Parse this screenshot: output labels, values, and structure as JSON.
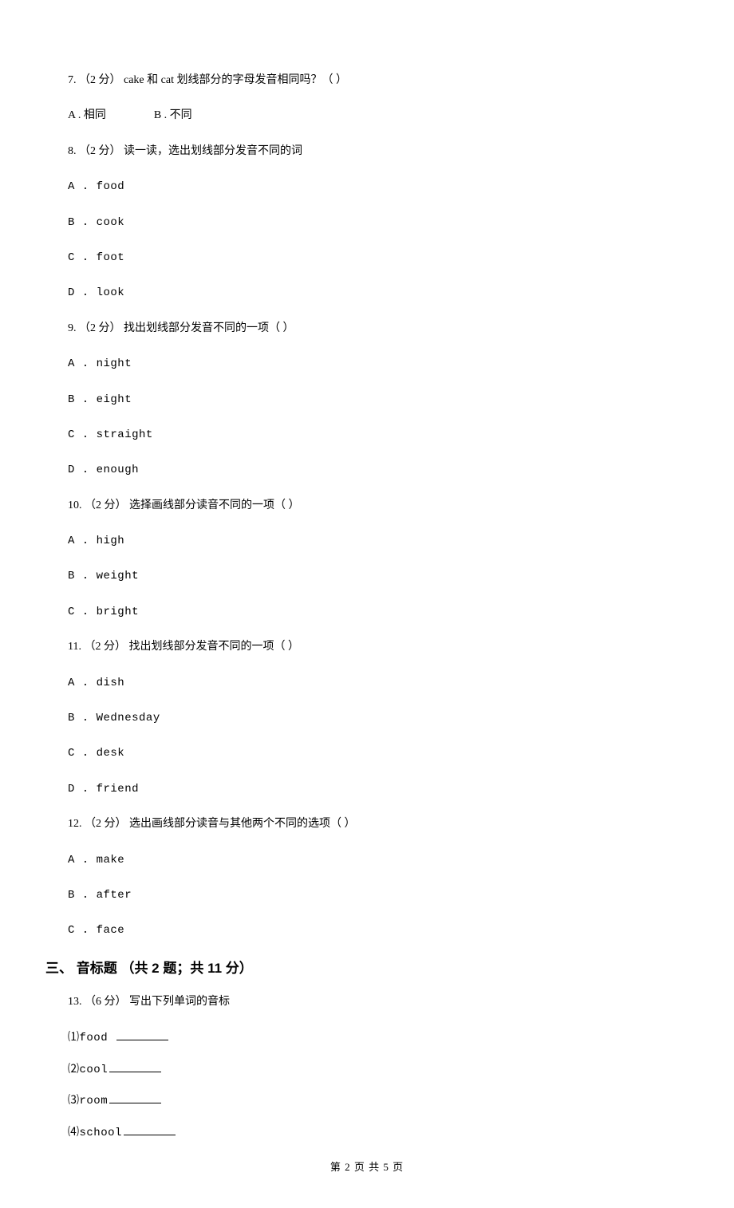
{
  "q7": {
    "stem": "7. （2 分） cake 和 cat 划线部分的字母发音相同吗？（    ）",
    "optA": "A . 相同",
    "optB": "B . 不同"
  },
  "q8": {
    "stem": "8. （2 分） 读一读，选出划线部分发音不同的词",
    "optA": "A . food",
    "optB": "B . cook",
    "optC": "C . foot",
    "optD": "D . look"
  },
  "q9": {
    "stem": "9. （2 分） 找出划线部分发音不同的一项（    ）",
    "optA": "A . night",
    "optB": "B . eight",
    "optC": "C . straight",
    "optD": "D . enough"
  },
  "q10": {
    "stem": "10. （2 分） 选择画线部分读音不同的一项（    ）",
    "optA": "A . high",
    "optB": "B . weight",
    "optC": "C . bright"
  },
  "q11": {
    "stem": "11. （2 分） 找出划线部分发音不同的一项（    ）",
    "optA": "A . dish",
    "optB": "B . Wednesday",
    "optC": "C . desk",
    "optD": "D . friend"
  },
  "q12": {
    "stem": "12. （2 分） 选出画线部分读音与其他两个不同的选项（    ）",
    "optA": "A . make",
    "optB": "B . after",
    "optC": "C . face"
  },
  "section3": {
    "title": "三、 音标题 （共 2 题；共 11 分）"
  },
  "q13": {
    "stem": "13. （6 分） 写出下列单词的音标",
    "sub1": "⑴food ",
    "sub2": "⑵cool",
    "sub3": "⑶room",
    "sub4": "⑷school"
  },
  "footer": "第 2 页 共 5 页"
}
